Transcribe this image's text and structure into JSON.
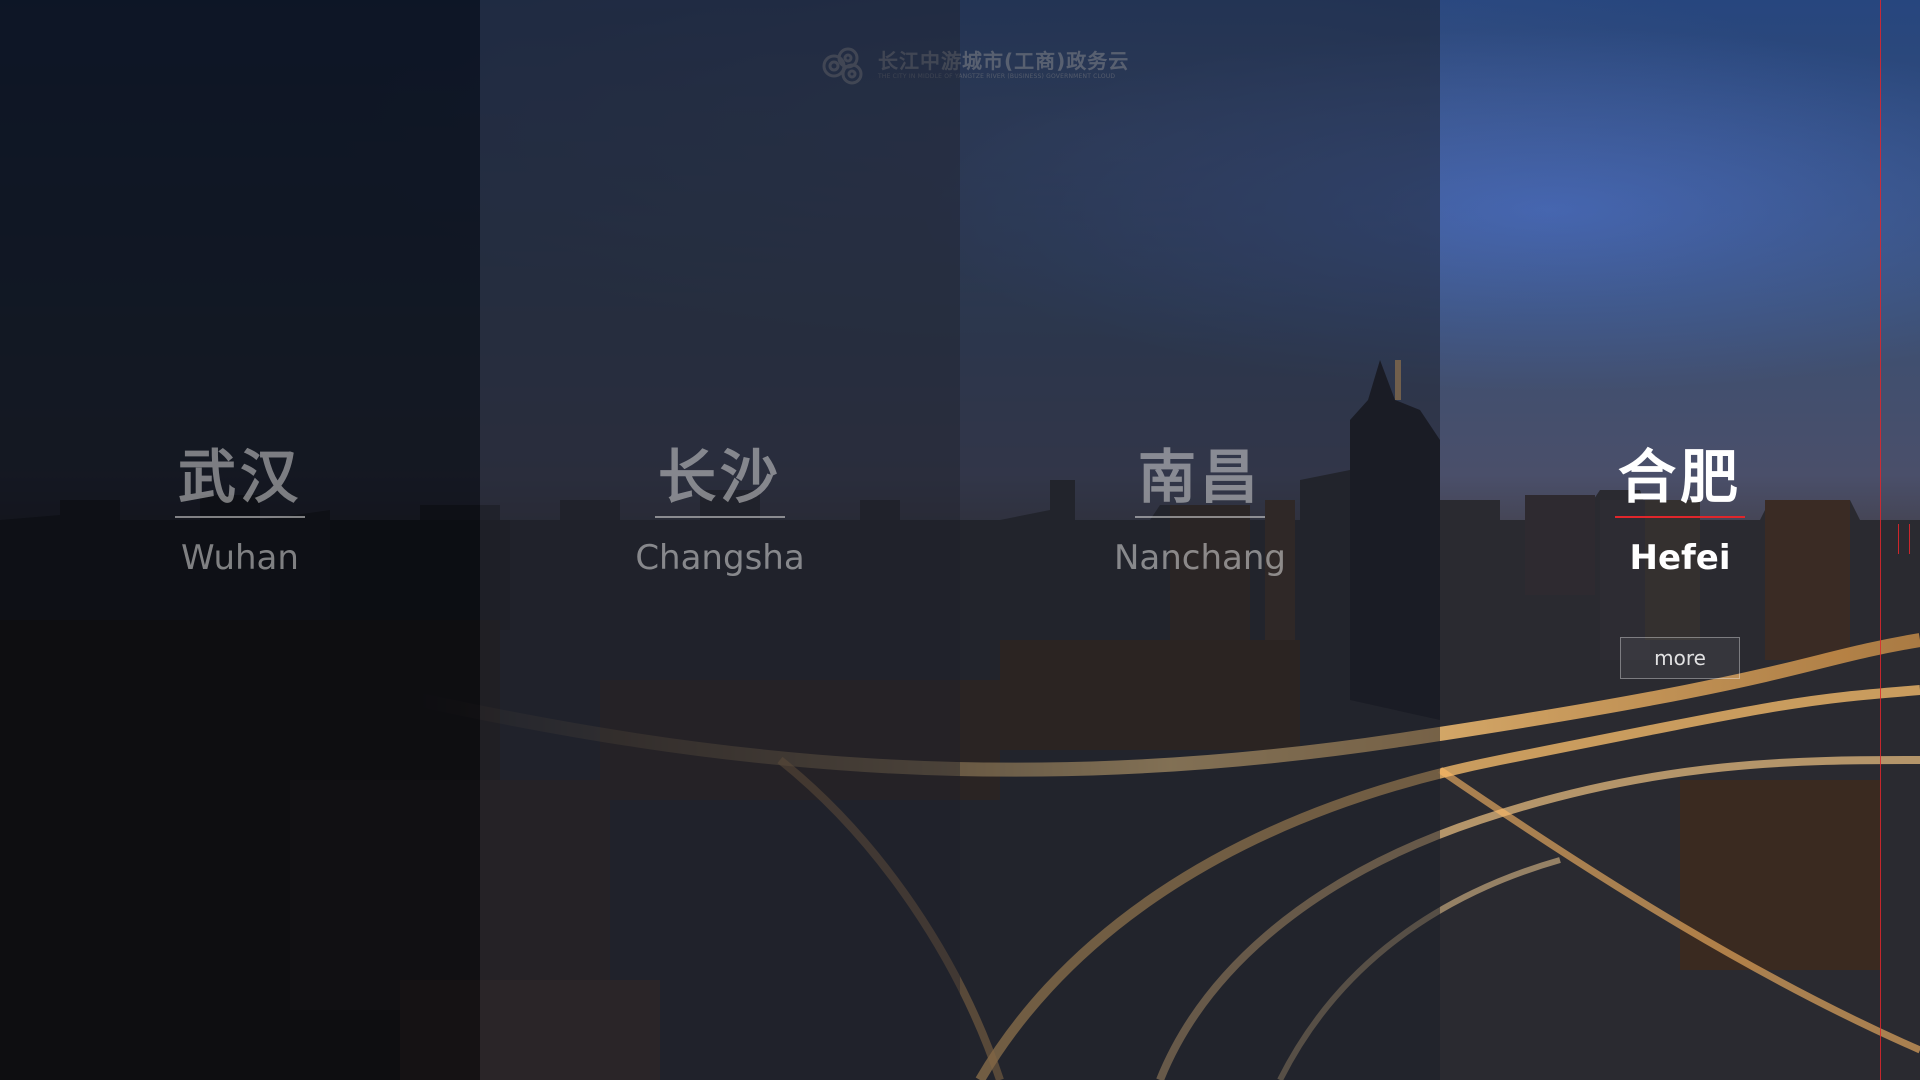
{
  "logo": {
    "title": "长江中游城市(工商)政务云",
    "subtitle": "THE CITY IN MIDDLE OF YANGTZE RIVER (BUSINESS) GOVERNMENT CLOUD",
    "icon": "cloud-swirl-icon"
  },
  "cities": [
    {
      "cn": "武汉",
      "en": "Wuhan",
      "active": false
    },
    {
      "cn": "长沙",
      "en": "Changsha",
      "active": false
    },
    {
      "cn": "南昌",
      "en": "Nanchang",
      "active": false
    },
    {
      "cn": "合肥",
      "en": "Hefei",
      "active": true
    }
  ],
  "more_label": "more",
  "colors": {
    "accent": "#e0262b",
    "text_active": "#ffffff",
    "text_inactive": "#d2d2d2"
  }
}
